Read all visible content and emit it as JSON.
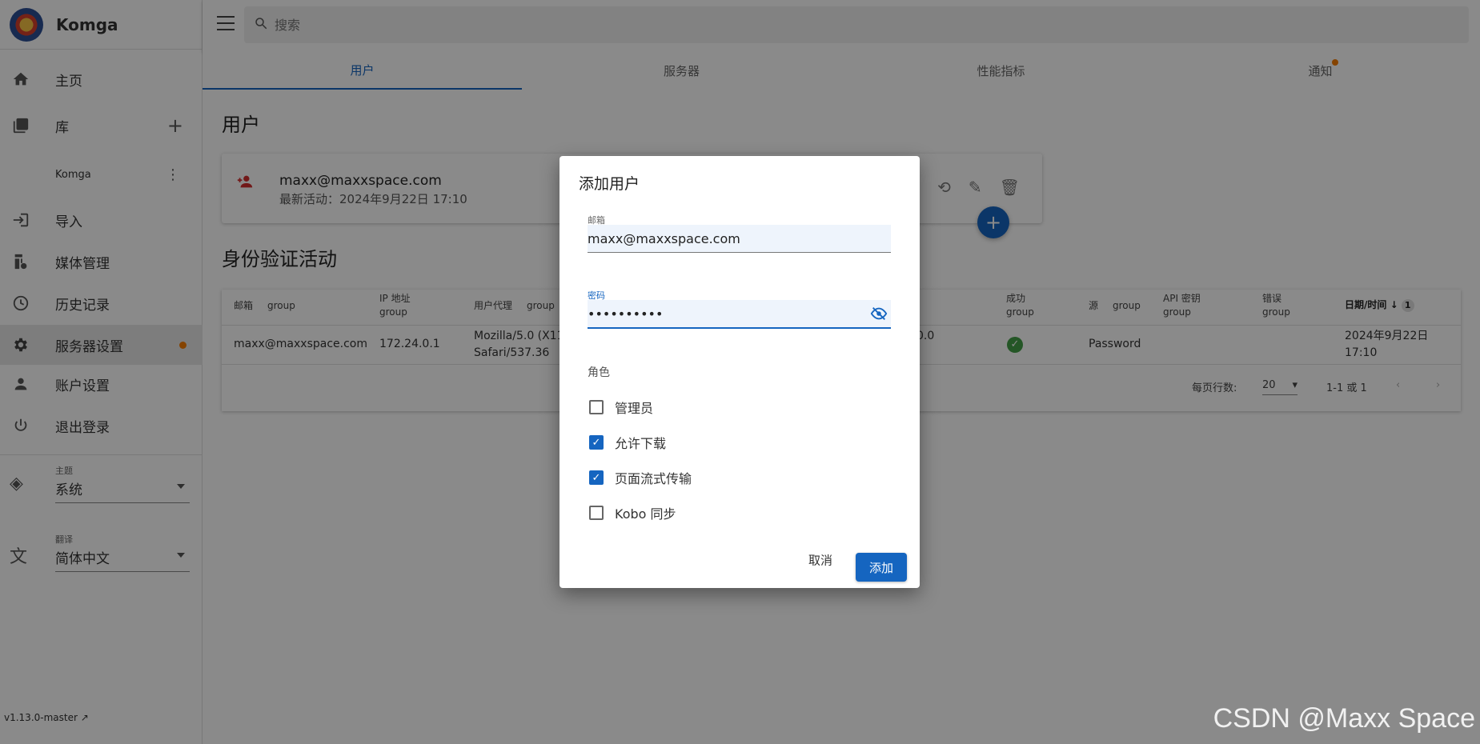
{
  "app": {
    "name": "Komga",
    "version": "v1.13.0-master"
  },
  "sidebar": {
    "items": [
      {
        "label": "主页",
        "icon": "home-icon"
      },
      {
        "label": "库",
        "icon": "library-icon"
      },
      {
        "label": "Komga",
        "icon": ""
      },
      {
        "label": "导入",
        "icon": "import-icon"
      },
      {
        "label": "媒体管理",
        "icon": "media-icon"
      },
      {
        "label": "历史记录",
        "icon": "history-icon"
      },
      {
        "label": "服务器设置",
        "icon": "gear-icon"
      },
      {
        "label": "账户设置",
        "icon": "account-icon"
      },
      {
        "label": "退出登录",
        "icon": "power-icon"
      }
    ],
    "theme": {
      "caption": "主题",
      "value": "系统"
    },
    "language": {
      "caption": "翻译",
      "value": "简体中文"
    }
  },
  "search": {
    "placeholder": "搜索"
  },
  "tabs": [
    "用户",
    "服务器",
    "性能指标",
    "通知"
  ],
  "users": {
    "heading": "用户",
    "card": {
      "email": "maxx@maxxspace.com",
      "activity": "最新活动：2024年9月22日 17:10"
    }
  },
  "auth": {
    "heading": "身份验证活动",
    "headers": {
      "email": "邮箱",
      "group": "group",
      "ip": "IP 地址",
      "ua": "用户代理",
      "success": "成功",
      "source": "源",
      "apikey": "API 密钥",
      "error": "错误",
      "datetime": "日期/时间",
      "sort_index": "1"
    },
    "row": {
      "email": "maxx@maxxspace.com",
      "ip": "172.24.0.1",
      "ua_line1": "Mozilla/5.0 (X11;",
      "ua_line2": "Safari/537.36",
      "ua_tail": "0.0",
      "source": "Password",
      "date": "2024年9月22日",
      "time": "17:10"
    },
    "footer": {
      "rows_label": "每页行数:",
      "rows_value": "20",
      "range": "1-1 或 1"
    }
  },
  "dialog": {
    "title": "添加用户",
    "email_label": "邮箱",
    "email_value": "maxx@maxxspace.com",
    "password_label": "密码",
    "password_value": "••••••••••",
    "roles_label": "角色",
    "roles": [
      {
        "label": "管理员",
        "checked": false
      },
      {
        "label": "允许下载",
        "checked": true
      },
      {
        "label": "页面流式传输",
        "checked": true
      },
      {
        "label": "Kobo 同步",
        "checked": false
      }
    ],
    "cancel_label": "取消",
    "add_label": "添加"
  },
  "watermark": "CSDN @Maxx Space",
  "colors": {
    "primary": "#1565c0",
    "accent": "#f57c00",
    "success": "#43a047",
    "danger": "#d32f2f"
  }
}
